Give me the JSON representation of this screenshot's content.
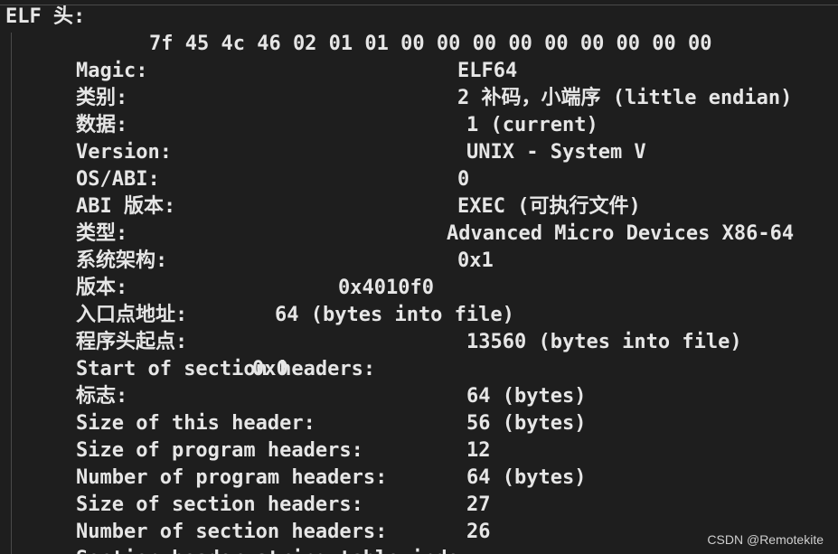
{
  "header": "ELF 头:",
  "fields": [
    {
      "key": "Magic:",
      "value": "7f 45 4c 46 02 01 01 00 00 00 00 00 00 00 00 00"
    },
    {
      "key": "类别:",
      "value": "ELF64"
    },
    {
      "key": "数据:",
      "value": "2 补码，小端序 (little endian)"
    },
    {
      "key": "Version:",
      "value": "1 (current)"
    },
    {
      "key": "OS/ABI:",
      "value": "UNIX - System V"
    },
    {
      "key": "ABI 版本:",
      "value": "0"
    },
    {
      "key": "类型:",
      "value": "EXEC (可执行文件)"
    },
    {
      "key": "系统架构:",
      "value": "Advanced Micro Devices X86-64"
    },
    {
      "key": "版本:",
      "value": "0x1"
    },
    {
      "key": "入口点地址:",
      "value": "0x4010f0"
    },
    {
      "key": "程序头起点:",
      "value": "64 (bytes into file)"
    },
    {
      "key": "Start of section headers:",
      "value": "13560 (bytes into file)"
    },
    {
      "key": "标志:",
      "value": "0x0"
    },
    {
      "key": "Size of this header:",
      "value": "64 (bytes)"
    },
    {
      "key": "Size of program headers:",
      "value": "56 (bytes)"
    },
    {
      "key": "Number of program headers:",
      "value": "12"
    },
    {
      "key": "Size of section headers:",
      "value": "64 (bytes)"
    },
    {
      "key": "Number of section headers:",
      "value": "27"
    },
    {
      "key": "Section header string table index:",
      "value": "26"
    }
  ],
  "watermark": "CSDN @Remotekite"
}
